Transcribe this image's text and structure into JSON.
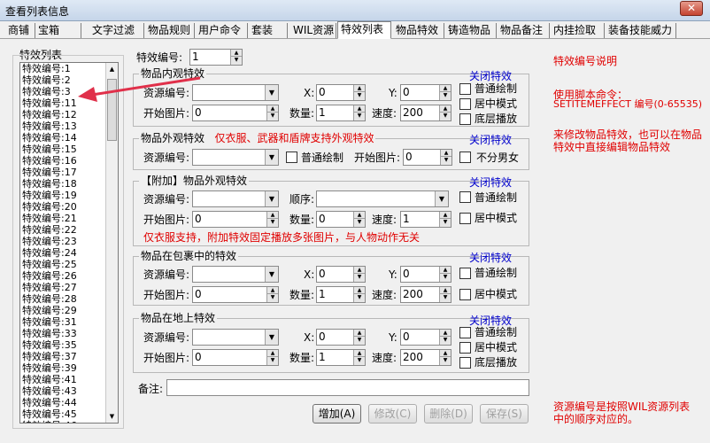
{
  "window": {
    "title": "查看列表信息",
    "close_symbol": "✕"
  },
  "tabs": [
    {
      "label": "商铺"
    },
    {
      "label": "宝箱"
    },
    {
      "label": "文字过滤"
    },
    {
      "label": "物品规则"
    },
    {
      "label": "用户命令"
    },
    {
      "label": "套装"
    },
    {
      "label": "WIL资源"
    },
    {
      "label": "特效列表",
      "active": true
    },
    {
      "label": "物品特效"
    },
    {
      "label": "铸造物品"
    },
    {
      "label": "物品备注"
    },
    {
      "label": "内挂捡取"
    },
    {
      "label": "装备技能威力"
    }
  ],
  "effect_list": {
    "title": "特效列表",
    "items": [
      "特效编号:1",
      "特效编号:2",
      "特效编号:3",
      "特效编号:11",
      "特效编号:12",
      "特效编号:13",
      "特效编号:14",
      "特效编号:15",
      "特效编号:16",
      "特效编号:17",
      "特效编号:18",
      "特效编号:19",
      "特效编号:20",
      "特效编号:21",
      "特效编号:22",
      "特效编号:23",
      "特效编号:24",
      "特效编号:25",
      "特效编号:26",
      "特效编号:27",
      "特效编号:28",
      "特效编号:29",
      "特效编号:31",
      "特效编号:33",
      "特效编号:35",
      "特效编号:37",
      "特效编号:39",
      "特效编号:41",
      "特效编号:43",
      "特效编号:44",
      "特效编号:45",
      "特效编号:46",
      "特效编号:47",
      "特效编号:48"
    ]
  },
  "effect_id": {
    "label": "特效编号:",
    "value": "1"
  },
  "labels": {
    "resource_id": "资源编号:",
    "x": "X:",
    "y": "Y:",
    "start_image": "开始图片:",
    "count": "数量:",
    "speed": "速度:",
    "order": "顺序:",
    "normal_draw": "普通绘制",
    "center_mode": "居中模式",
    "bottom_play": "底层播放",
    "no_gender": "不分男女",
    "close_effect": "关闭特效",
    "note": "备注:"
  },
  "groups": {
    "inner": {
      "title": "物品内观特效",
      "x": "0",
      "y": "0",
      "start": "0",
      "count": "1",
      "speed": "200"
    },
    "outer": {
      "title": "物品外观特效",
      "note": "仅衣服、武器和盾牌支持外观特效",
      "start": "0"
    },
    "extra": {
      "title": "【附加】物品外观特效",
      "start": "0",
      "count": "0",
      "speed": "1",
      "note": "仅衣服支持，附加特效固定播放多张图片，与人物动作无关"
    },
    "bag": {
      "title": "物品在包裹中的特效",
      "x": "0",
      "y": "0",
      "start": "0",
      "count": "1",
      "speed": "200"
    },
    "ground": {
      "title": "物品在地上特效",
      "x": "0",
      "y": "0",
      "start": "0",
      "count": "1",
      "speed": "200"
    }
  },
  "buttons": {
    "add": "增加(A)",
    "modify": "修改(C)",
    "delete": "删除(D)",
    "save": "保存(S)"
  },
  "help": {
    "heading": "特效编号说明",
    "command_label": "使用脚本命令：",
    "command": "SETITEMEFFECT 编号(0-65535)",
    "desc": "来修改物品特效，也可以在物品特效中直接编辑物品特效",
    "footer": "资源编号是按照WIL资源列表中的顺序对应的。"
  },
  "colors": {
    "red": "#e00000",
    "blue": "#0000cc",
    "arrow": "#e0304a"
  }
}
